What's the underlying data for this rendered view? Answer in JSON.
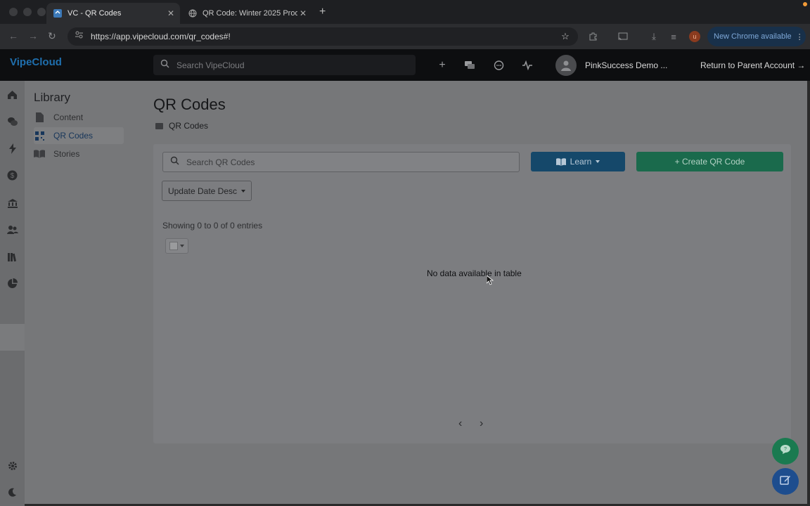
{
  "browser": {
    "tabs": [
      {
        "title": "VC - QR Codes",
        "active": true
      },
      {
        "title": "QR Code: Winter 2025 Produ",
        "active": false
      }
    ],
    "url": "https://app.vipecloud.com/qr_codes#!",
    "update_label": "New Chrome available",
    "profile_initial": "u"
  },
  "header": {
    "logo": "VipeCloud",
    "search_placeholder": "Search VipeCloud",
    "account_name": "PinkSuccess Demo ...",
    "return_label": "Return to Parent Account →"
  },
  "sidebar": {
    "title": "Library",
    "items": [
      {
        "label": "Content",
        "active": false
      },
      {
        "label": "QR Codes",
        "active": true
      },
      {
        "label": "Stories",
        "active": false
      }
    ]
  },
  "main": {
    "title": "QR Codes",
    "breadcrumb": "QR Codes",
    "search_placeholder": "Search QR Codes",
    "learn_label": "Learn",
    "create_label": "+ Create QR Code",
    "sort_label": "Update Date Desc",
    "entries_text": "Showing 0 to 0 of 0 entries",
    "empty_text": "No data available in table",
    "prev_label": "‹",
    "next_label": "›"
  },
  "colors": {
    "learn_button": "#15486a",
    "create_button": "#1a6a4c",
    "chat_fab": "#1a7a50",
    "edit_fab": "#1d4d8e"
  }
}
